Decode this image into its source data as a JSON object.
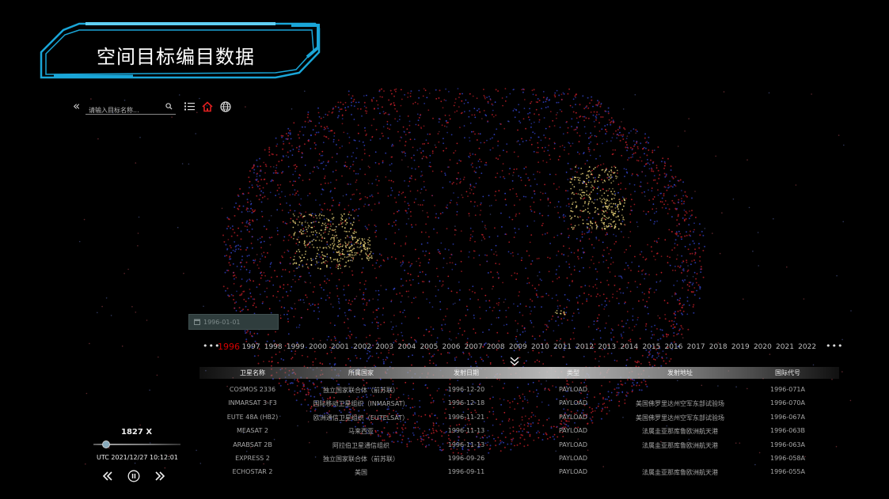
{
  "title": "空间目标编目数据",
  "search": {
    "placeholder": "请输入目标名称..."
  },
  "date_badge": "1996-01-01",
  "years": [
    "1996",
    "1997",
    "1998",
    "1999",
    "2000",
    "2001",
    "2002",
    "2003",
    "2004",
    "2005",
    "2006",
    "2007",
    "2008",
    "2009",
    "2010",
    "2011",
    "2012",
    "2013",
    "2014",
    "2015",
    "2016",
    "2017",
    "2018",
    "2019",
    "2020",
    "2021",
    "2022"
  ],
  "active_year": "1996",
  "more_glyph": "•••",
  "table": {
    "headers": [
      "卫星名称",
      "所属国家",
      "发射日期",
      "类型",
      "发射地址",
      "国际代号"
    ],
    "rows": [
      [
        "COSMOS 2336",
        "独立国家联合体（前苏联）",
        "1996-12-20",
        "PAYLOAD",
        "",
        "1996-071A"
      ],
      [
        "INMARSAT 3-F3",
        "国际移动卫星组织（INMARSAT）",
        "1996-12-18",
        "PAYLOAD",
        "美国佛罗里达州空军东部试验场",
        "1996-070A"
      ],
      [
        "EUTE 48A (HB2)",
        "欧洲通信卫星组织（EUTELSAT）",
        "1996-11-21",
        "PAYLOAD",
        "美国佛罗里达州空军东部试验场",
        "1996-067A"
      ],
      [
        "MEASAT 2",
        "马来西亚",
        "1996-11-13",
        "PAYLOAD",
        "法属圭亚那库鲁欧洲航天港",
        "1996-063B"
      ],
      [
        "ARABSAT 2B",
        "阿拉伯卫星通信组织",
        "1996-11-13",
        "PAYLOAD",
        "法属圭亚那库鲁欧洲航天港",
        "1996-063A"
      ],
      [
        "EXPRESS 2",
        "独立国家联合体（前苏联）",
        "1996-09-26",
        "PAYLOAD",
        "",
        "1996-058A"
      ],
      [
        "ECHOSTAR 2",
        "美国",
        "1996-09-11",
        "PAYLOAD",
        "法属圭亚那库鲁欧洲航天港",
        "1996-055A"
      ]
    ]
  },
  "playback": {
    "speed": "1827 X",
    "utc_time": "UTC  2021/12/27 10:12:01",
    "slider_fraction": 0.14
  },
  "colors": {
    "accent_cyan": "#1aa6d8",
    "active_year": "#d40000",
    "debris_red": "#c8202a",
    "debris_blue": "#3344cc",
    "city_lights": "#e8d27a"
  },
  "icons": [
    "collapse-left-icon",
    "search-icon",
    "list-icon",
    "home-icon",
    "globe-icon",
    "calendar-icon",
    "chevrons-down-icon",
    "rewind-icon",
    "pause-icon",
    "fast-forward-icon"
  ]
}
